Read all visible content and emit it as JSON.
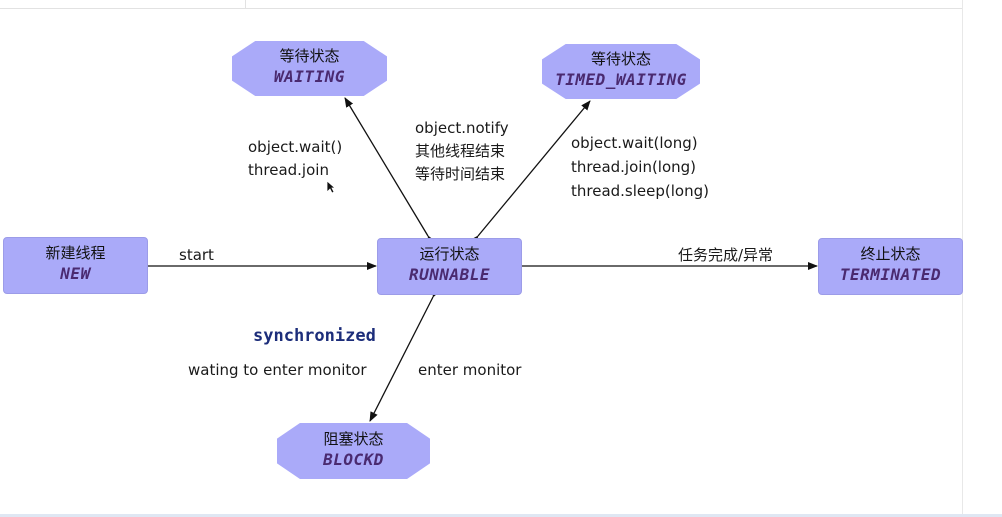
{
  "states": {
    "new": {
      "zh": "新建线程",
      "en": "NEW"
    },
    "runnable": {
      "zh": "运行状态",
      "en": "RUNNABLE"
    },
    "terminated": {
      "zh": "终止状态",
      "en": "TERMINATED"
    },
    "waiting": {
      "zh": "等待状态",
      "en": "WAITING"
    },
    "timed_waiting": {
      "zh": "等待状态",
      "en": "TIMED_WAITING"
    },
    "blocked": {
      "zh": "阻塞状态",
      "en": "BLOCKD"
    }
  },
  "transitions": {
    "start": "start",
    "complete": "任务完成/异常",
    "wait_lines": [
      "object.wait()",
      "thread.join"
    ],
    "notify_lines": [
      "object.notify",
      "其他线程结束",
      "等待时间结束"
    ],
    "timed_lines": [
      "object.wait(long)",
      "thread.join(long)",
      "thread.sleep(long)"
    ],
    "synchronized": "synchronized",
    "waiting_monitor": "wating to enter monitor",
    "enter_monitor": "enter monitor"
  },
  "colors": {
    "node_fill": "#aaaaf9",
    "keyword": "#1c2d7a",
    "state_en": "#4a2a70",
    "arrow": "#111111"
  }
}
